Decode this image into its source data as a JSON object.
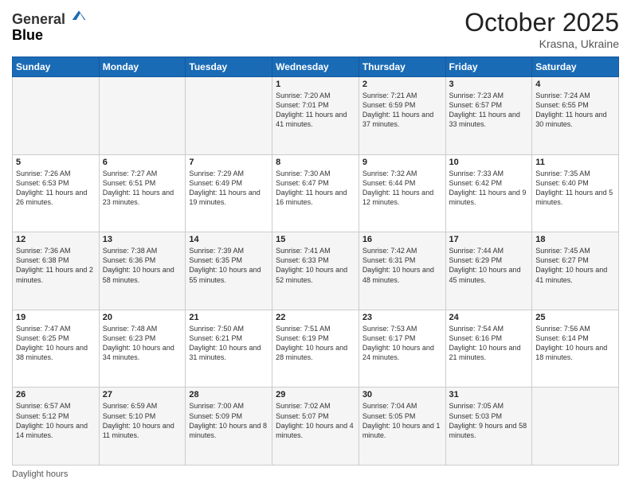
{
  "header": {
    "logo_line1": "General",
    "logo_line2": "Blue",
    "month": "October 2025",
    "location": "Krasna, Ukraine"
  },
  "weekdays": [
    "Sunday",
    "Monday",
    "Tuesday",
    "Wednesday",
    "Thursday",
    "Friday",
    "Saturday"
  ],
  "footer": {
    "daylight_label": "Daylight hours"
  },
  "rows": [
    [
      {
        "day": "",
        "text": ""
      },
      {
        "day": "",
        "text": ""
      },
      {
        "day": "",
        "text": ""
      },
      {
        "day": "1",
        "text": "Sunrise: 7:20 AM\nSunset: 7:01 PM\nDaylight: 11 hours and 41 minutes."
      },
      {
        "day": "2",
        "text": "Sunrise: 7:21 AM\nSunset: 6:59 PM\nDaylight: 11 hours and 37 minutes."
      },
      {
        "day": "3",
        "text": "Sunrise: 7:23 AM\nSunset: 6:57 PM\nDaylight: 11 hours and 33 minutes."
      },
      {
        "day": "4",
        "text": "Sunrise: 7:24 AM\nSunset: 6:55 PM\nDaylight: 11 hours and 30 minutes."
      }
    ],
    [
      {
        "day": "5",
        "text": "Sunrise: 7:26 AM\nSunset: 6:53 PM\nDaylight: 11 hours and 26 minutes."
      },
      {
        "day": "6",
        "text": "Sunrise: 7:27 AM\nSunset: 6:51 PM\nDaylight: 11 hours and 23 minutes."
      },
      {
        "day": "7",
        "text": "Sunrise: 7:29 AM\nSunset: 6:49 PM\nDaylight: 11 hours and 19 minutes."
      },
      {
        "day": "8",
        "text": "Sunrise: 7:30 AM\nSunset: 6:47 PM\nDaylight: 11 hours and 16 minutes."
      },
      {
        "day": "9",
        "text": "Sunrise: 7:32 AM\nSunset: 6:44 PM\nDaylight: 11 hours and 12 minutes."
      },
      {
        "day": "10",
        "text": "Sunrise: 7:33 AM\nSunset: 6:42 PM\nDaylight: 11 hours and 9 minutes."
      },
      {
        "day": "11",
        "text": "Sunrise: 7:35 AM\nSunset: 6:40 PM\nDaylight: 11 hours and 5 minutes."
      }
    ],
    [
      {
        "day": "12",
        "text": "Sunrise: 7:36 AM\nSunset: 6:38 PM\nDaylight: 11 hours and 2 minutes."
      },
      {
        "day": "13",
        "text": "Sunrise: 7:38 AM\nSunset: 6:36 PM\nDaylight: 10 hours and 58 minutes."
      },
      {
        "day": "14",
        "text": "Sunrise: 7:39 AM\nSunset: 6:35 PM\nDaylight: 10 hours and 55 minutes."
      },
      {
        "day": "15",
        "text": "Sunrise: 7:41 AM\nSunset: 6:33 PM\nDaylight: 10 hours and 52 minutes."
      },
      {
        "day": "16",
        "text": "Sunrise: 7:42 AM\nSunset: 6:31 PM\nDaylight: 10 hours and 48 minutes."
      },
      {
        "day": "17",
        "text": "Sunrise: 7:44 AM\nSunset: 6:29 PM\nDaylight: 10 hours and 45 minutes."
      },
      {
        "day": "18",
        "text": "Sunrise: 7:45 AM\nSunset: 6:27 PM\nDaylight: 10 hours and 41 minutes."
      }
    ],
    [
      {
        "day": "19",
        "text": "Sunrise: 7:47 AM\nSunset: 6:25 PM\nDaylight: 10 hours and 38 minutes."
      },
      {
        "day": "20",
        "text": "Sunrise: 7:48 AM\nSunset: 6:23 PM\nDaylight: 10 hours and 34 minutes."
      },
      {
        "day": "21",
        "text": "Sunrise: 7:50 AM\nSunset: 6:21 PM\nDaylight: 10 hours and 31 minutes."
      },
      {
        "day": "22",
        "text": "Sunrise: 7:51 AM\nSunset: 6:19 PM\nDaylight: 10 hours and 28 minutes."
      },
      {
        "day": "23",
        "text": "Sunrise: 7:53 AM\nSunset: 6:17 PM\nDaylight: 10 hours and 24 minutes."
      },
      {
        "day": "24",
        "text": "Sunrise: 7:54 AM\nSunset: 6:16 PM\nDaylight: 10 hours and 21 minutes."
      },
      {
        "day": "25",
        "text": "Sunrise: 7:56 AM\nSunset: 6:14 PM\nDaylight: 10 hours and 18 minutes."
      }
    ],
    [
      {
        "day": "26",
        "text": "Sunrise: 6:57 AM\nSunset: 5:12 PM\nDaylight: 10 hours and 14 minutes."
      },
      {
        "day": "27",
        "text": "Sunrise: 6:59 AM\nSunset: 5:10 PM\nDaylight: 10 hours and 11 minutes."
      },
      {
        "day": "28",
        "text": "Sunrise: 7:00 AM\nSunset: 5:09 PM\nDaylight: 10 hours and 8 minutes."
      },
      {
        "day": "29",
        "text": "Sunrise: 7:02 AM\nSunset: 5:07 PM\nDaylight: 10 hours and 4 minutes."
      },
      {
        "day": "30",
        "text": "Sunrise: 7:04 AM\nSunset: 5:05 PM\nDaylight: 10 hours and 1 minute."
      },
      {
        "day": "31",
        "text": "Sunrise: 7:05 AM\nSunset: 5:03 PM\nDaylight: 9 hours and 58 minutes."
      },
      {
        "day": "",
        "text": ""
      }
    ]
  ]
}
